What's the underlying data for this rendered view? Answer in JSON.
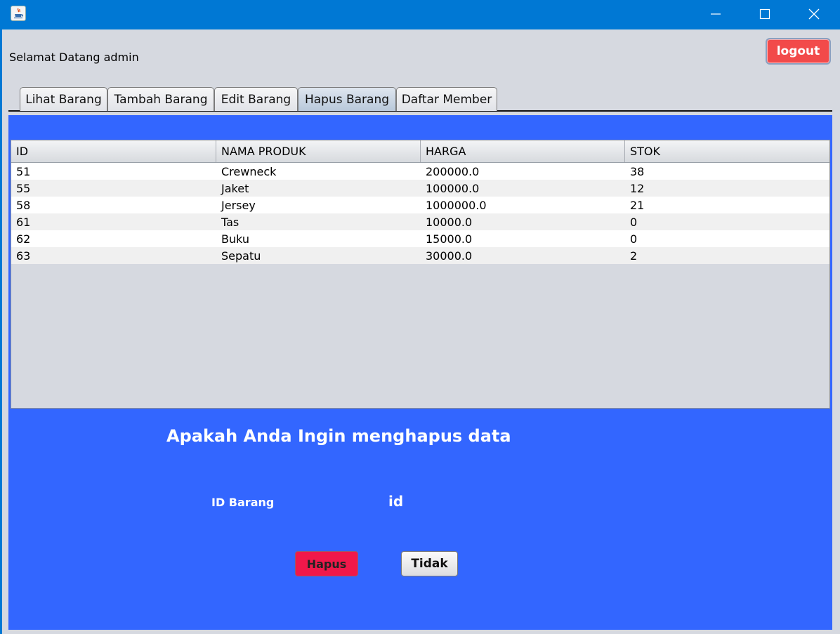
{
  "window": {
    "minimize_glyph": "—",
    "maximize_glyph": "☐",
    "close_glyph": "✕"
  },
  "header": {
    "welcome": "Selamat Datang admin",
    "logout_label": "logout"
  },
  "tabs": [
    {
      "label": "Lihat Barang"
    },
    {
      "label": "Tambah Barang"
    },
    {
      "label": "Edit Barang"
    },
    {
      "label": "Hapus Barang",
      "active": true
    },
    {
      "label": "Daftar Member"
    }
  ],
  "table": {
    "columns": [
      "ID",
      "NAMA PRODUK",
      "HARGA",
      "STOK"
    ],
    "rows": [
      [
        "51",
        "Crewneck",
        "200000.0",
        "38"
      ],
      [
        "55",
        "Jaket",
        "100000.0",
        "12"
      ],
      [
        "58",
        "Jersey",
        "1000000.0",
        "21"
      ],
      [
        "61",
        "Tas",
        "10000.0",
        "0"
      ],
      [
        "62",
        "Buku",
        "15000.0",
        "0"
      ],
      [
        "63",
        "Sepatu",
        "30000.0",
        "2"
      ]
    ]
  },
  "confirm": {
    "question": "Apakah Anda Ingin menghapus data",
    "id_label": "ID Barang",
    "id_value": "id",
    "hapus_label": "Hapus",
    "tidak_label": "Tidak"
  },
  "colors": {
    "panel_bg": "#3366ff",
    "logout_bg": "#f24a4a",
    "hapus_bg": "#f0184a",
    "titlebar_bg": "#0078d4"
  }
}
